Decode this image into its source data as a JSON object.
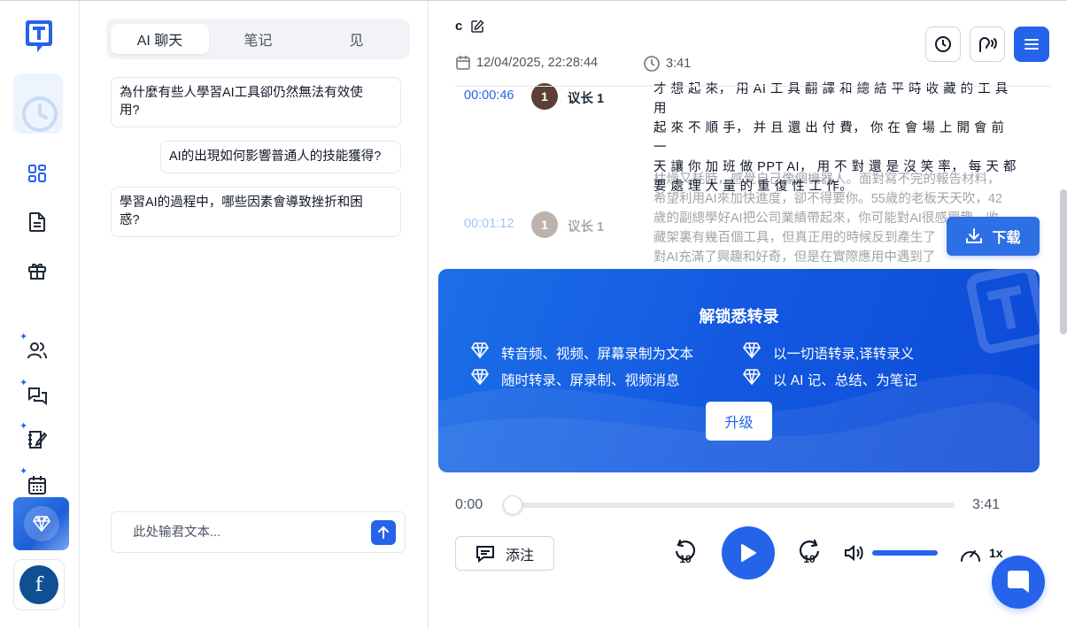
{
  "rail": {
    "items": [
      "dashboard-icon",
      "document-icon",
      "gift-icon",
      "users-icon",
      "chat-icon",
      "notebook-icon",
      "calendar-icon"
    ],
    "avatar_letter": "f"
  },
  "chat": {
    "tabs": [
      {
        "label": "AI 聊天",
        "active": true
      },
      {
        "label": "笔记",
        "active": false
      },
      {
        "label": "见",
        "active": false
      }
    ],
    "suggestions": [
      "為什麼有些人學習AI工具卻仍然無法有效使",
      "用?",
      "AI的出現如何影響普通人的技能獲得?",
      "學習AI的過程中，哪些因素會導致挫折和困",
      "惑?"
    ],
    "input_placeholder": "此处输君文本..."
  },
  "header": {
    "title": "c",
    "date": "12/04/2025, 22:28:44",
    "duration": "3:41"
  },
  "transcript": [
    {
      "time": "00:00:46",
      "speaker_num": "1",
      "speaker": "议长 1",
      "lines": [
        "才 想 起 來， 用 AI 工 具 翻 譯 和 總 結 平 時 收 藏 的 工 具 用",
        "起 來 不 順 手， 并 且 還 出 付 費， 你 在 會 場 上 開 會 前 一",
        "天 讓 你 加 班 做 PPT AI， 用 不 對 還 是 沒 笑 率， 每 天 都",
        "要 處 理 大 量 的 重 復 性 工 作。"
      ]
    },
    {
      "time": "00:01:12",
      "speaker_num": "1",
      "speaker": "议长 1",
      "lines": [
        "枯燥又耗時，感覺自己像個機器人。面對寫不完的報告材料，",
        "希望利用AI來加快進度，卻不得要你。55歲的老板天天吹，42",
        "歲的副總學好AI把公司業績帶起來，你可能對AI很感興趣，收",
        "藏架裏有幾百個工具，但真正用的時候反到產生了",
        "對AI充滿了興趣和好奇，但是在實際應用中遇到了"
      ]
    }
  ],
  "download_label": "下载",
  "promo": {
    "title": "解锁悉转录",
    "features": [
      "转音频、视频、屏幕录制为文本",
      "以一切语转录,译转录义",
      "随时转录、屏录制、视频消息",
      "以 AI 记、总结、为笔记"
    ],
    "button": "升级"
  },
  "player": {
    "current": "0:00",
    "total": "3:41",
    "progress": 0.0,
    "volume": 1.0,
    "annotate_label": "添注",
    "skip_back": "10",
    "skip_fwd": "10",
    "speed": "1x"
  }
}
